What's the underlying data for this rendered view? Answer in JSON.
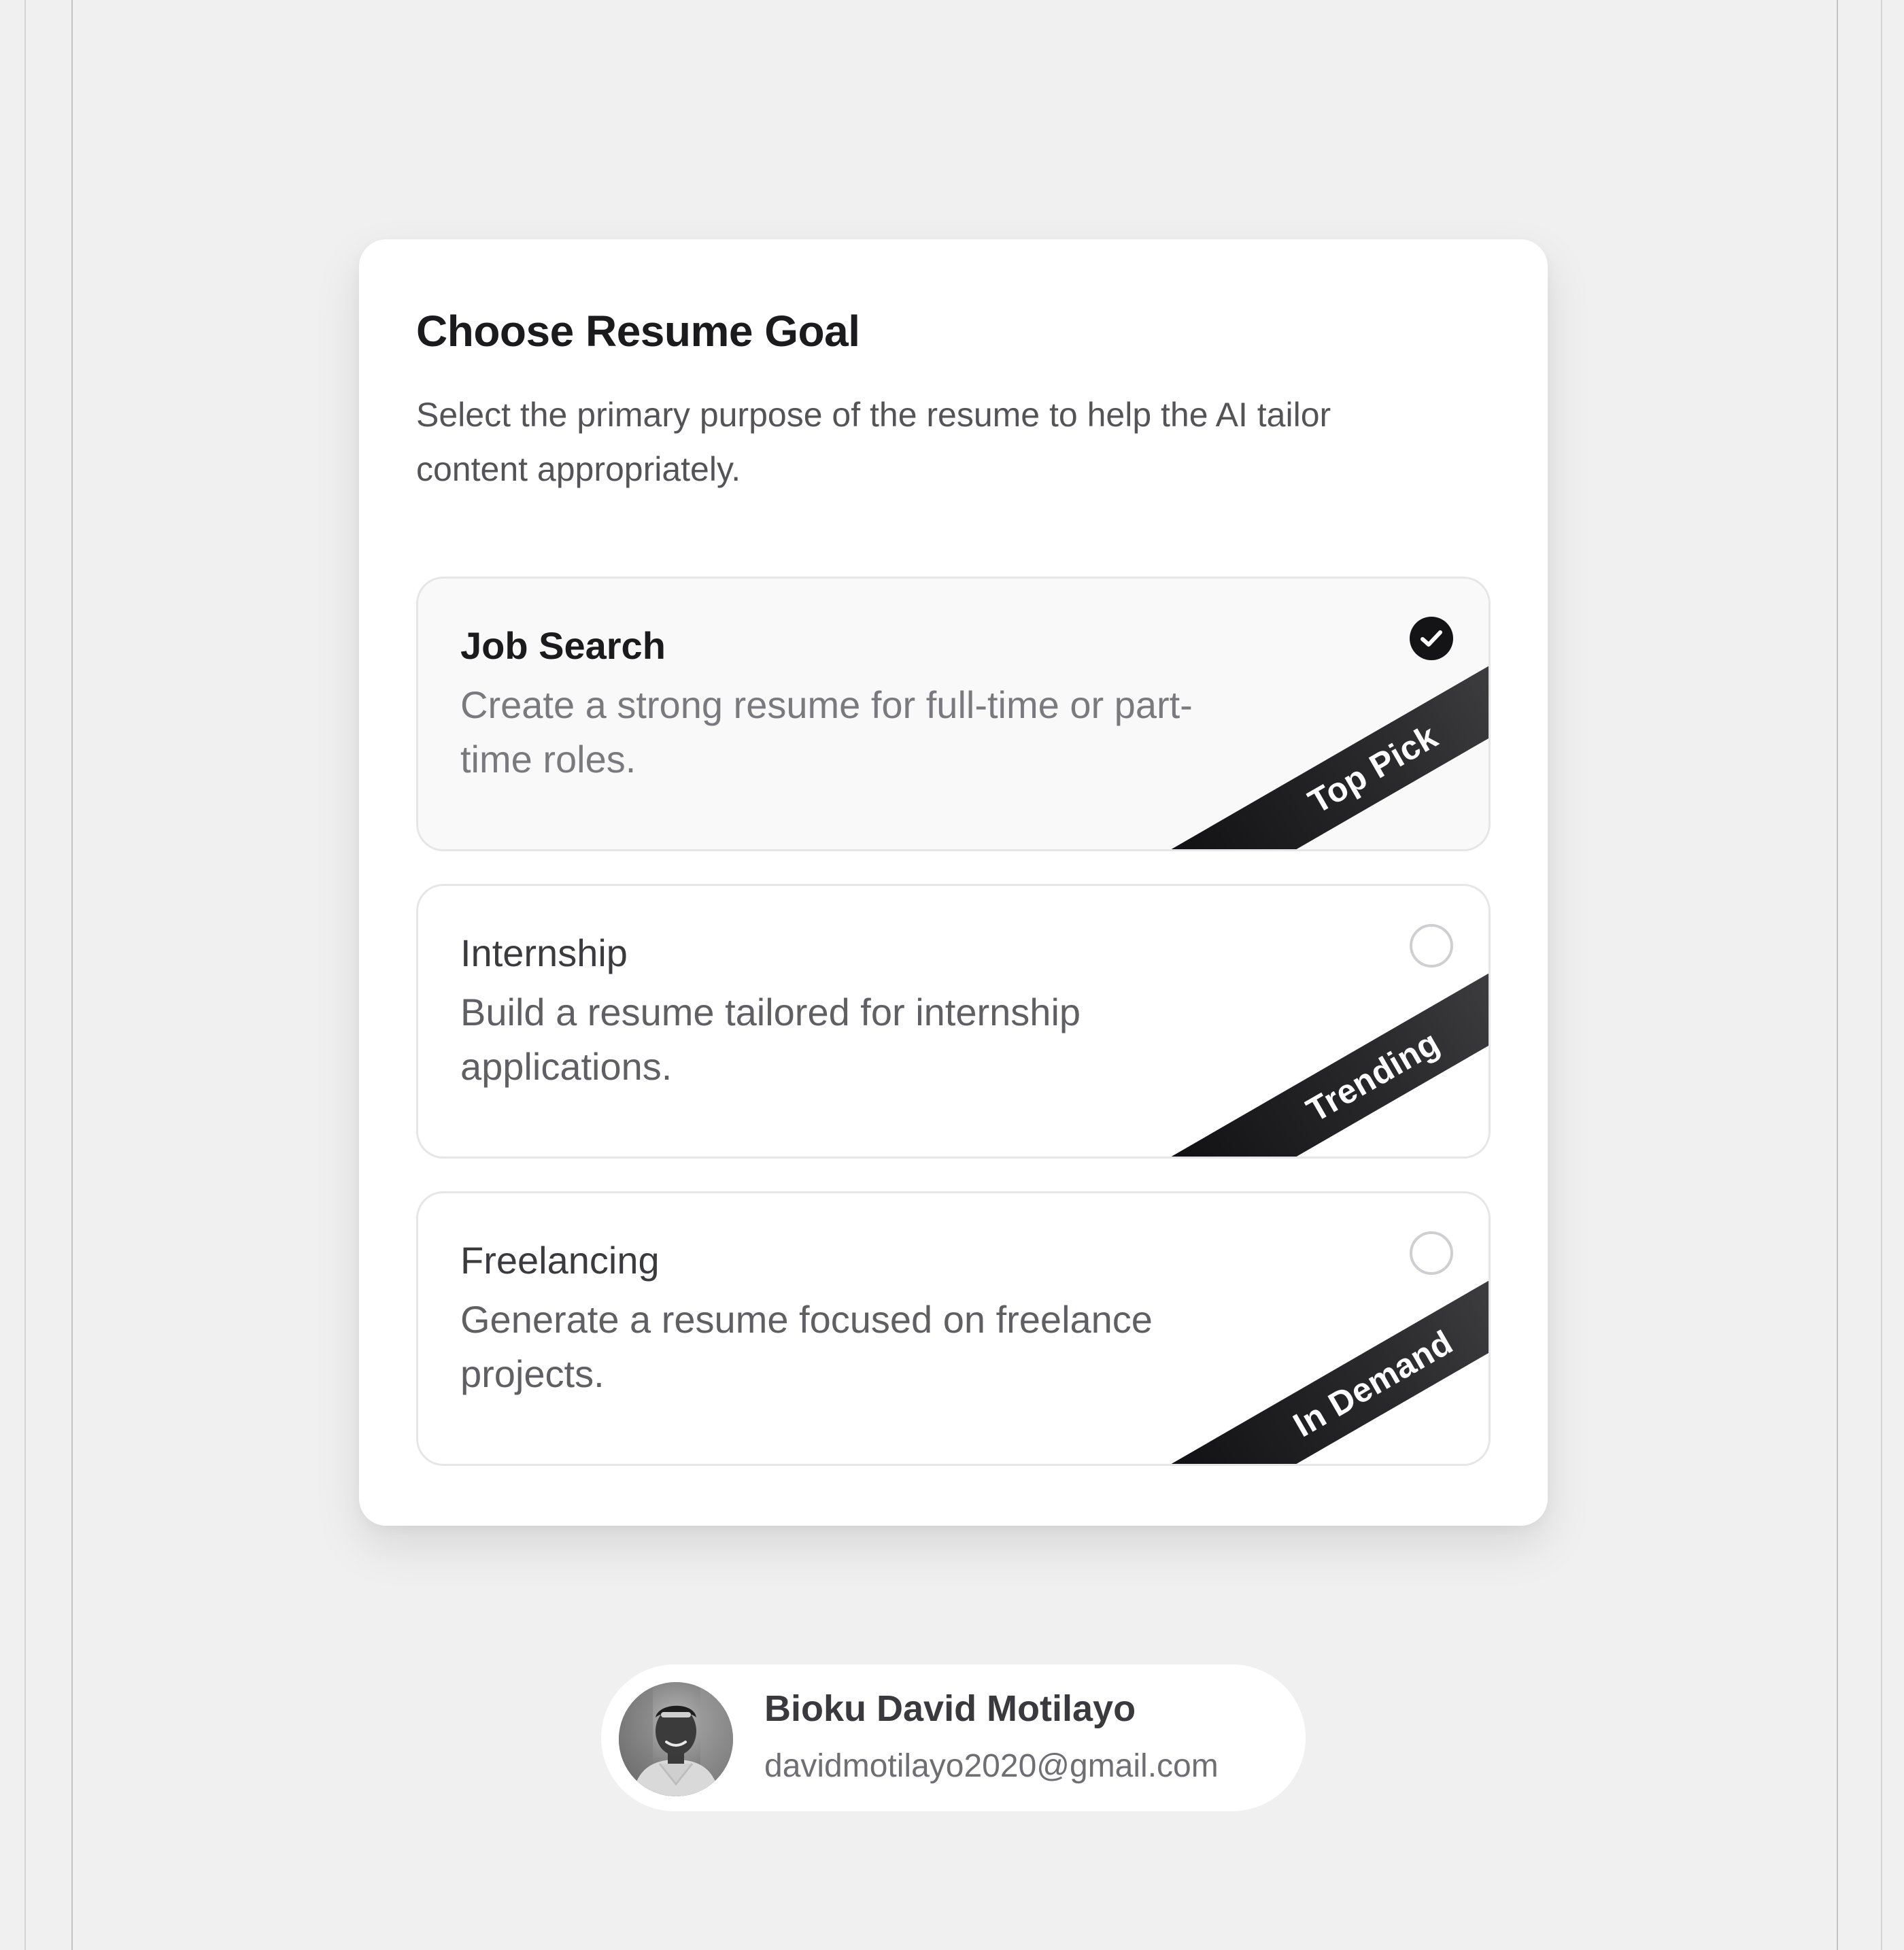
{
  "card": {
    "title": "Choose Resume Goal",
    "subtitle": "Select the primary purpose of the resume to help the AI tailor content appropriately."
  },
  "options": [
    {
      "title": "Job Search",
      "description": "Create a strong resume for full-time or part-time roles.",
      "badge": "Top Pick",
      "selected": true
    },
    {
      "title": "Internship",
      "description": "Build a resume tailored for internship applications.",
      "badge": "Trending",
      "selected": false
    },
    {
      "title": "Freelancing",
      "description": "Generate a resume focused on freelance projects.",
      "badge": "In Demand",
      "selected": false
    }
  ],
  "profile": {
    "name": "Bioku David Motilayo",
    "email": "davidmotilayo2020@gmail.com"
  },
  "colors": {
    "background": "#f0f0f0",
    "card": "#ffffff",
    "accent": "#141416",
    "option_border": "#e6e6e8"
  }
}
